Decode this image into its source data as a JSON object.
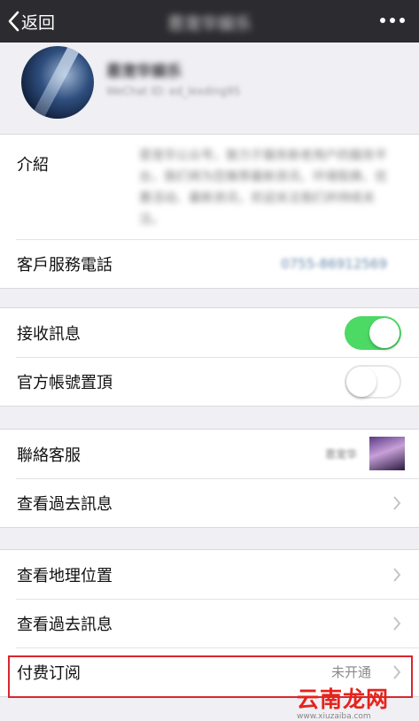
{
  "navbar": {
    "back_label": "返回",
    "title": "恩宠华娱乐"
  },
  "profile": {
    "name": "恩宠华娱乐",
    "wechat_id": "WeChat ID: ed_lexding95"
  },
  "intro": {
    "label": "介紹",
    "text": "恩宠华公众号，致力于服务新老用户的服务平台，我们将为您推荐最新资讯、环境取换、优惠活动、最新资讯，欢迎关注我们并持续关注。"
  },
  "phone_row": {
    "label": "客戶服務電話",
    "value": "0755-86912569"
  },
  "receive_messages": {
    "label": "接收訊息",
    "enabled": true
  },
  "pin_account": {
    "label": "官方帳號置頂",
    "enabled": false
  },
  "contact_service": {
    "label": "聯絡客服",
    "name": "恩宠华"
  },
  "history_1": {
    "label": "查看過去訊息"
  },
  "location": {
    "label": "查看地理位置"
  },
  "history_2": {
    "label": "查看過去訊息"
  },
  "paid_subscription": {
    "label": "付费订阅",
    "status": "未开通"
  },
  "watermark": {
    "text": "云南龙网",
    "url": "www.xiuzaiba.com"
  },
  "colors": {
    "toggle_on": "#4cd964",
    "highlight": "#d9262d",
    "navbar": "#2c2c30"
  }
}
